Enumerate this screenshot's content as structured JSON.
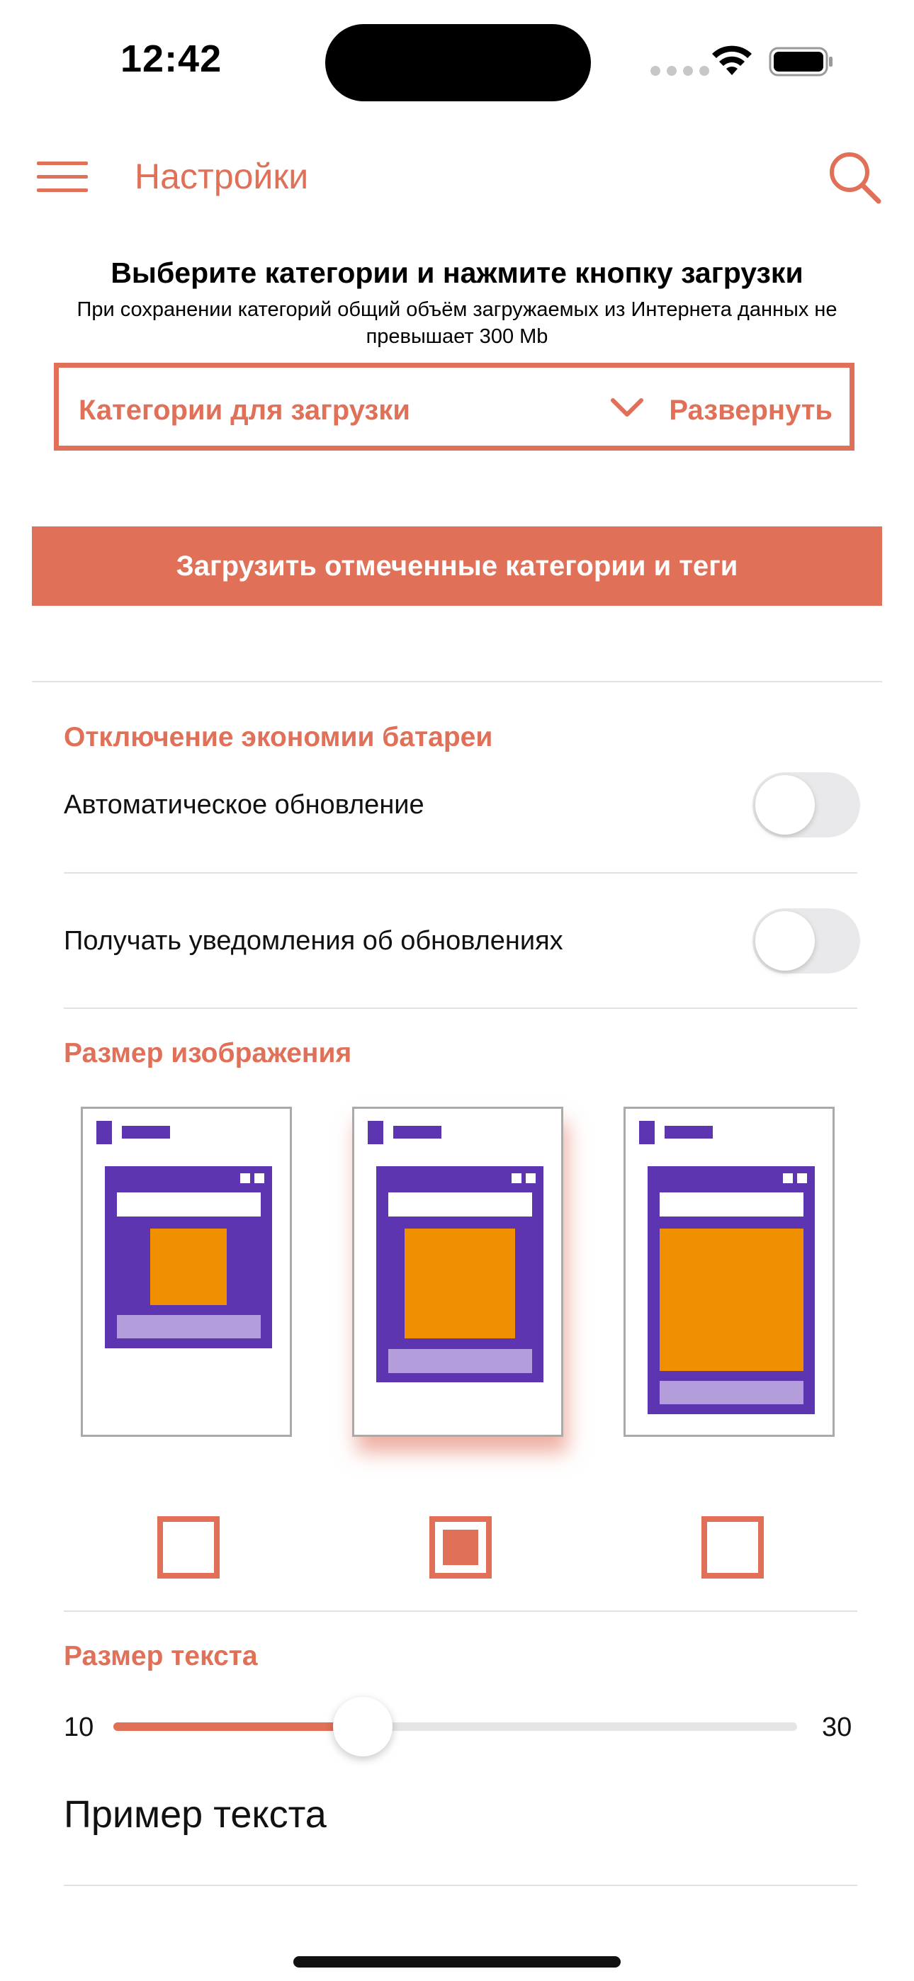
{
  "status_bar": {
    "time": "12:42"
  },
  "header": {
    "title": "Настройки"
  },
  "intro": {
    "heading": "Выберите категории и нажмите кнопку загрузки",
    "description": "При сохранении категорий общий объём загружаемых из Интернета данных не превышает  300 Mb"
  },
  "categories": {
    "label": "Категории для загрузки",
    "expand_label": "Развернуть"
  },
  "download_button": {
    "label": "Загрузить отмеченные категории и теги"
  },
  "battery_section": {
    "title": "Отключение экономии батареи",
    "items": [
      {
        "label": "Автоматическое обновление",
        "enabled": false
      },
      {
        "label": "Получать уведомления об обновлениях",
        "enabled": false
      }
    ]
  },
  "image_size": {
    "title": "Размер изображения",
    "options": [
      {
        "id": "small",
        "selected": false
      },
      {
        "id": "medium",
        "selected": true
      },
      {
        "id": "large",
        "selected": false
      }
    ]
  },
  "text_size": {
    "title": "Размер текста",
    "min_label": "10",
    "max_label": "30",
    "min": 10,
    "max": 30,
    "value": 17.3,
    "sample": "Пример текста"
  },
  "colors": {
    "accent": "#e07058",
    "purple": "#5e35b1",
    "orange": "#f09000",
    "light_purple": "#b39ddb",
    "toggle_off": "#e9e9eb"
  }
}
